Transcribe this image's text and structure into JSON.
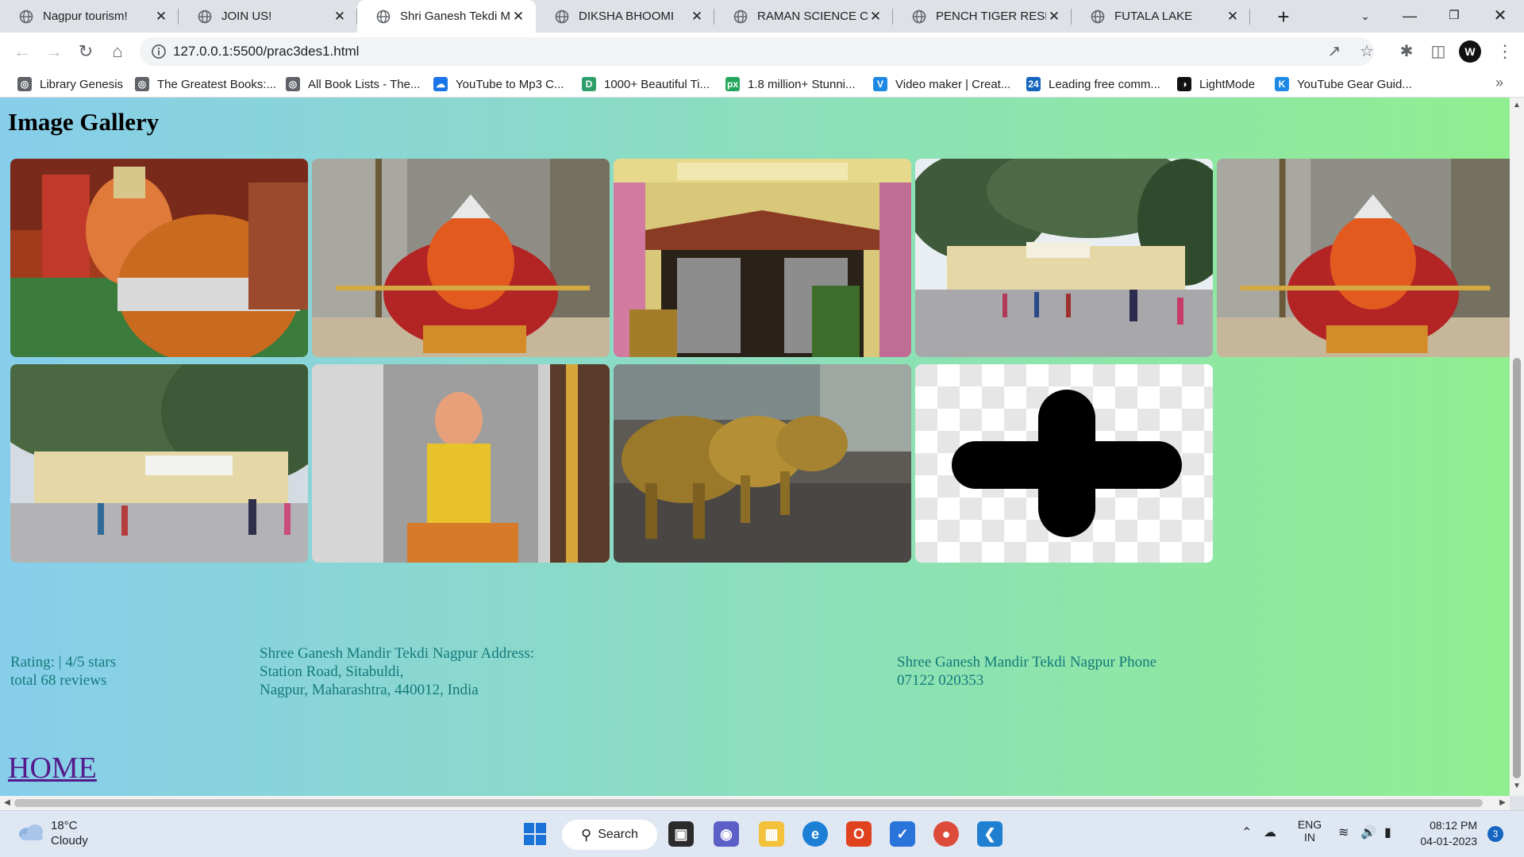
{
  "browser": {
    "tabs": [
      {
        "title": "Nagpur tourism!",
        "active": false
      },
      {
        "title": "JOIN US!",
        "active": false
      },
      {
        "title": "Shri Ganesh Tekdi Ma",
        "active": true
      },
      {
        "title": "DIKSHA BHOOMI",
        "active": false
      },
      {
        "title": "RAMAN SCIENCE CEN",
        "active": false
      },
      {
        "title": "PENCH TIGER RESERV",
        "active": false
      },
      {
        "title": "FUTALA LAKE",
        "active": false
      }
    ],
    "url": "127.0.0.1:5500/prac3des1.html",
    "bookmarks": [
      {
        "label": "Library Genesis",
        "icon": "globe-icon",
        "color": "#5f6368"
      },
      {
        "label": "The Greatest Books:...",
        "icon": "globe-icon",
        "color": "#5f6368"
      },
      {
        "label": "All Book Lists - The...",
        "icon": "globe-icon",
        "color": "#5f6368"
      },
      {
        "label": "YouTube to Mp3 C...",
        "icon": "download-cloud-icon",
        "color": "#1a73e8"
      },
      {
        "label": "1000+ Beautiful Ti...",
        "icon": "d-logo-icon",
        "color": "#2e9e6b"
      },
      {
        "label": "1.8 million+ Stunni...",
        "icon": "px-logo-icon",
        "color": "#26a65b"
      },
      {
        "label": "Video maker | Creat...",
        "icon": "v-logo-icon",
        "color": "#1e88e5"
      },
      {
        "label": "Leading free comm...",
        "icon": "24-logo-icon",
        "color": "#1565c0"
      },
      {
        "label": "LightMode",
        "icon": "lightmode-logo-icon",
        "color": "#111111"
      },
      {
        "label": "YouTube Gear Guid...",
        "icon": "k-logo-icon",
        "color": "#1e88e5"
      }
    ]
  },
  "page": {
    "title": "Image Gallery",
    "gallery": [
      {
        "name": "ganesh-idol-pot"
      },
      {
        "name": "ganesh-idol-crowned"
      },
      {
        "name": "temple-entrance"
      },
      {
        "name": "temple-courtyard"
      },
      {
        "name": "ganesh-idol-crowned-2"
      },
      {
        "name": "temple-courtyard-2"
      },
      {
        "name": "silver-deity-shrine"
      },
      {
        "name": "brass-elephants"
      },
      {
        "name": "add-image-placeholder"
      }
    ],
    "rating": {
      "line1": "Rating: | 4/5 stars",
      "line2": "total 68 reviews"
    },
    "address": {
      "line1": "Shree Ganesh Mandir Tekdi Nagpur Address:",
      "line2": "Station Road, Sitabuldi,",
      "line3": "Nagpur, Maharashtra, 440012, India"
    },
    "phone": {
      "line1": "Shree Ganesh Mandir Tekdi Nagpur Phone",
      "line2": "07122 020353"
    },
    "home_link": "HOME",
    "colors": {
      "gradient_start": "#87ceeb",
      "gradient_end": "#90ee90",
      "info_text": "#147a7a",
      "link": "#551a8b"
    }
  },
  "taskbar": {
    "weather": {
      "temp": "18°C",
      "condition": "Cloudy"
    },
    "search_label": "Search",
    "language": {
      "line1": "ENG",
      "line2": "IN"
    },
    "time": "08:12 PM",
    "date": "04-01-2023",
    "notifications": "3"
  }
}
